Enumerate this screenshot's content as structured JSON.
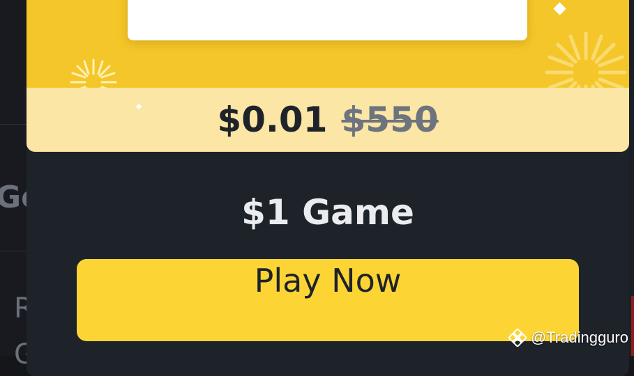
{
  "background_page": {
    "partial_text_1": "Ge",
    "partial_text_2": "R",
    "partial_text_3": "G"
  },
  "promo": {
    "price_now": "$0.01",
    "price_old": "$550",
    "game_title": "$1 Game",
    "play_button_label": "Play Now"
  },
  "watermark": {
    "handle": "@Tradingguro",
    "icon": "binance-logo-icon"
  },
  "colors": {
    "hero_yellow": "#f5c629",
    "price_strip": "#fbe6a6",
    "modal_bg": "#1e2329",
    "button_yellow": "#fcd535",
    "title_text": "#eaecef",
    "old_price_gray": "#6d747e"
  }
}
